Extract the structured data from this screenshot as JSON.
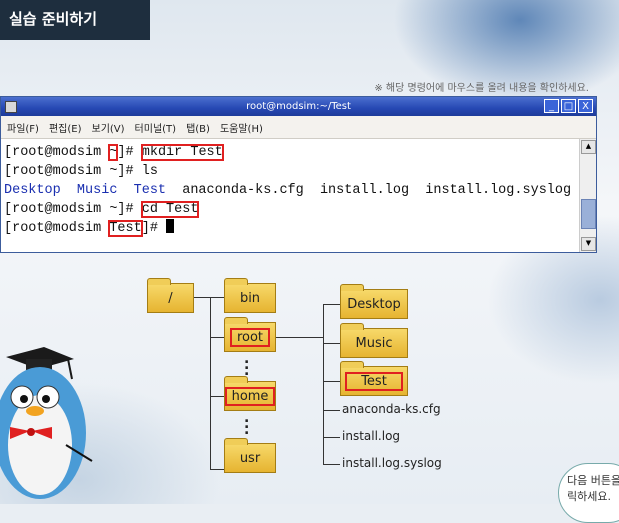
{
  "header": {
    "title": "실습 준비하기"
  },
  "notice": "※ 해당 명령어에 마우스를 올려 내용을 확인하세요.",
  "window": {
    "title": "root@modsim:~/Test",
    "menu": [
      "파일(F)",
      "편집(E)",
      "보기(V)",
      "터미널(T)",
      "탭(B)",
      "도움말(H)"
    ],
    "controls": [
      "_",
      "□",
      "X"
    ]
  },
  "terminal": {
    "line1": {
      "prompt_a": "[root@modsim ",
      "tilde": "~",
      "prompt_b": "]# ",
      "cmd": "mkdir Test"
    },
    "line2": {
      "prompt": "[root@modsim ~]# ",
      "cmd": "ls"
    },
    "line3": {
      "dirs": "Desktop  Music  Test",
      "files": "  anaconda-ks.cfg  install.log  install.log.syslog"
    },
    "line4": {
      "prompt": "[root@modsim ~]# ",
      "cmd": "cd Test"
    },
    "line5": {
      "prompt_a": "[root@modsim ",
      "dir": "Test",
      "prompt_b": "]# "
    }
  },
  "tree": {
    "root": "/",
    "level1": [
      "bin",
      "root",
      "home",
      "usr"
    ],
    "level2": [
      "Desktop",
      "Music",
      "Test"
    ],
    "files": [
      "anaconda-ks.cfg",
      "install.log",
      "install.log.syslog"
    ]
  },
  "next_hint": "다음 버튼을 클릭하세요."
}
